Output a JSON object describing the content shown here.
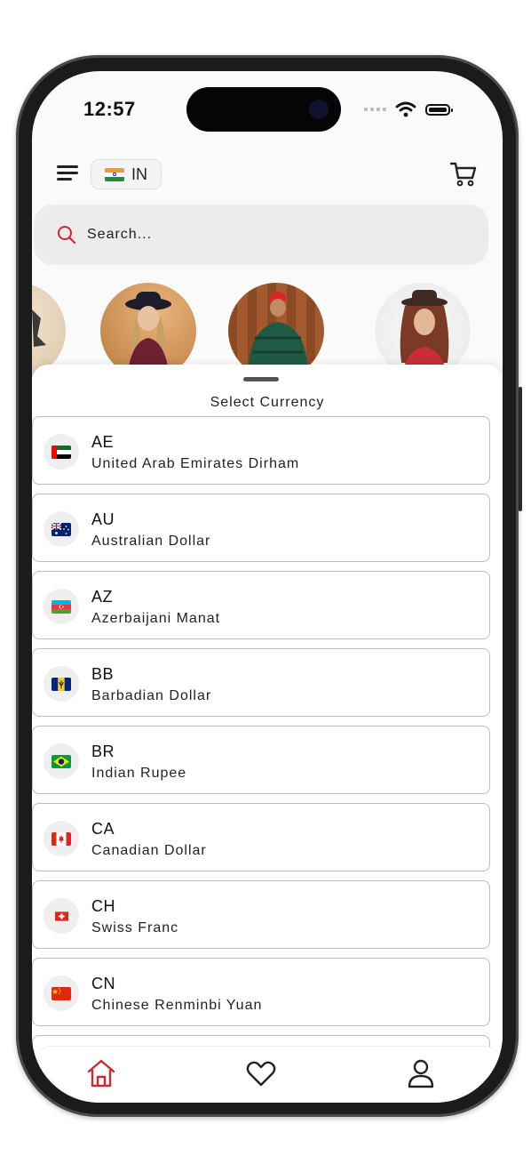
{
  "status_bar": {
    "time": "12:57"
  },
  "header": {
    "menu_icon": "hamburger-menu-icon",
    "country_chip": {
      "code": "IN",
      "flag": "india-flag"
    },
    "cart_icon": "shopping-cart-icon"
  },
  "search": {
    "placeholder": "Search...",
    "icon": "search-icon"
  },
  "stories": [
    {
      "name": "story-avatar-1"
    },
    {
      "name": "story-avatar-2"
    },
    {
      "name": "story-avatar-3"
    },
    {
      "name": "story-avatar-4"
    }
  ],
  "currency_sheet": {
    "title": "Select Currency",
    "items": [
      {
        "code": "AE",
        "name": "United Arab Emirates Dirham",
        "flag": "uae-flag"
      },
      {
        "code": "AU",
        "name": "Australian Dollar",
        "flag": "australia-flag"
      },
      {
        "code": "AZ",
        "name": "Azerbaijani Manat",
        "flag": "azerbaijan-flag"
      },
      {
        "code": "BB",
        "name": "Barbadian Dollar",
        "flag": "barbados-flag"
      },
      {
        "code": "BR",
        "name": "Indian Rupee",
        "flag": "brazil-flag"
      },
      {
        "code": "CA",
        "name": "Canadian Dollar",
        "flag": "canada-flag"
      },
      {
        "code": "CH",
        "name": "Swiss Franc",
        "flag": "switzerland-flag"
      },
      {
        "code": "CN",
        "name": "Chinese Renminbi Yuan",
        "flag": "china-flag"
      }
    ]
  },
  "bottom_nav": [
    {
      "name": "home",
      "icon": "home-icon",
      "active": true
    },
    {
      "name": "wishlist",
      "icon": "heart-icon",
      "active": false
    },
    {
      "name": "profile",
      "icon": "user-icon",
      "active": false
    }
  ],
  "colors": {
    "accent": "#d0282f",
    "sheet_bg": "#ffffff",
    "border": "#bdbdbd"
  }
}
